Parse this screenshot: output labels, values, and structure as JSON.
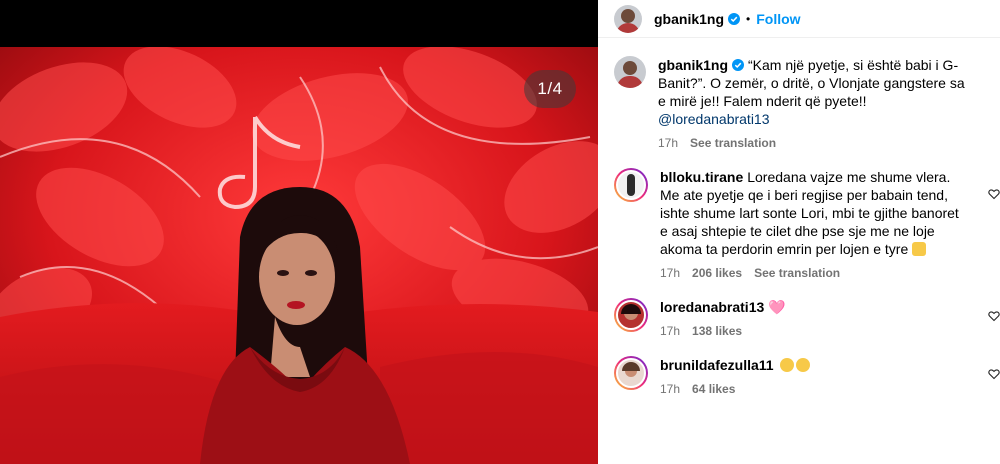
{
  "media": {
    "counter": "1/4"
  },
  "header": {
    "username": "gbanik1ng",
    "separator": "•",
    "follow_label": "Follow"
  },
  "caption": {
    "username": "gbanik1ng",
    "text": "“Kam një pyetje, si është babi i G-Banit?”. O zemër, o dritë, o Vlonjate gangstere sa e mirë je!! Falem nderit që pyete!! ",
    "mention": "@loredanabrati13",
    "time": "17h",
    "translate": "See translation"
  },
  "comments": [
    {
      "username": "blloku.tirane",
      "text": "Loredana vajze me shume vlera. Me ate pyetje qe i beri regjise per babain tend, ishte shume lart sonte Lori, mbi te gjithe banoret e asaj shtepie te cilet dhe pse sje me ne loje akoma ta perdorin emrin per lojen e tyre",
      "time": "17h",
      "likes": "206 likes",
      "translate": "See translation"
    },
    {
      "username": "loredanabrati13",
      "text": "🩷",
      "time": "17h",
      "likes": "138 likes"
    },
    {
      "username": "brunildafezulla11",
      "text": "",
      "time": "17h",
      "likes": "64 likes"
    }
  ],
  "colors": {
    "link": "#0095f6",
    "mention": "#00376b",
    "muted": "#737373",
    "background_red": "#d8151b"
  }
}
